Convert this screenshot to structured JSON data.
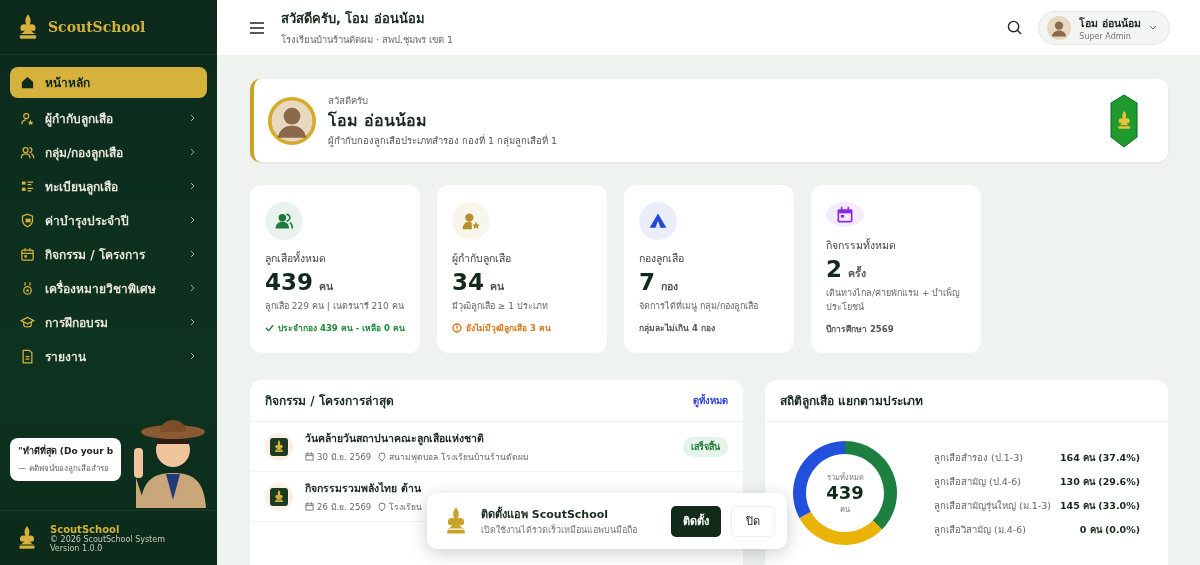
{
  "sidebar": {
    "brand": "ScoutSchool",
    "items": [
      {
        "label": "หน้าหลัก",
        "selected": true,
        "expandable": false
      },
      {
        "label": "ผู้กำกับลูกเสือ",
        "selected": false,
        "expandable": true
      },
      {
        "label": "กลุ่ม/กองลูกเสือ",
        "selected": false,
        "expandable": true
      },
      {
        "label": "ทะเบียนลูกเสือ",
        "selected": false,
        "expandable": true
      },
      {
        "label": "ค่าบำรุงประจำปี",
        "selected": false,
        "expandable": true
      },
      {
        "label": "กิจกรรม / โครงการ",
        "selected": false,
        "expandable": true
      },
      {
        "label": "เครื่องหมายวิชาพิเศษ",
        "selected": false,
        "expandable": true
      },
      {
        "label": "การฝึกอบรม",
        "selected": false,
        "expandable": true
      },
      {
        "label": "รายงาน",
        "selected": false,
        "expandable": true
      }
    ],
    "quote": {
      "text": "\"ทำดีที่สุด (Do your b",
      "source": "— คติพจน์ของลูกเสือสำรอ"
    },
    "footer": {
      "name": "ScoutSchool",
      "copyright": "© 2026 ScoutSchool System",
      "version": "Version 1.0.0"
    }
  },
  "topbar": {
    "greeting": "สวัสดีครับ, โอม อ่อนน้อม",
    "school": "โรงเรียนบ้านร้านตัดผม · สพป.ชุมพร เขต 1",
    "user": {
      "name": "โอม อ่อนน้อม",
      "role": "Super Admin"
    }
  },
  "welcome": {
    "hello": "สวัสดีครับ",
    "name": "โอม อ่อนน้อม",
    "position": "ผู้กำกับกองลูกเสือประเภทสำรอง กองที่ 1 กลุ่มลูกเสือที่ 1"
  },
  "stats": [
    {
      "color": "#1e7a3c",
      "label": "ลูกเสือทั้งหมด",
      "value": "439",
      "unit": "คน",
      "detail": "ลูกเสือ 229 คน | เนตรนารี 210 คน",
      "note": "ประจำกอง 439 คน - เหลือ 0 คน",
      "kind": "ok"
    },
    {
      "color": "#b8912a",
      "label": "ผู้กำกับลูกเสือ",
      "value": "34",
      "unit": "คน",
      "detail": "มีวุฒิลูกเสือ ≥ 1 ประเภท",
      "note": "ยังไม่มีวุฒิลูกเสือ 3 คน",
      "kind": "warning"
    },
    {
      "color": "#2348d8",
      "label": "กองลูกเสือ",
      "value": "7",
      "unit": "กอง",
      "detail": "จัดการได้ที่เมนู กลุ่ม/กองลูกเสือ",
      "note": "กลุ่มละไม่เกิน 4 กอง",
      "kind": "plain"
    },
    {
      "color": "#8a2be2",
      "label": "กิจกรรมทั้งหมด",
      "value": "2",
      "unit": "ครั้ง",
      "detail": "เดินทางไกล/ค่ายพักแรม + บำเพ็ญประโยชน์",
      "note": "ปีการศึกษา 2569",
      "kind": "plain"
    }
  ],
  "activities": {
    "title": "กิจกรรม / โครงการล่าสุด",
    "link": "ดูทั้งหมด",
    "items": [
      {
        "title": "วันคล้ายวันสถาปนาคณะลูกเสือแห่งชาติ",
        "date": "30 มิ.ย. 2569",
        "place": "สนามฟุตบอล โรงเรียนบ้านร้านตัดผม",
        "status": "เสร็จสิ้น"
      },
      {
        "title": "กิจกรรมรวมพลังไทย ต้าน",
        "date": "26 มิ.ย. 2569",
        "place": "โรงเรียน"
      }
    ]
  },
  "scout_stats": {
    "title": "สถิติลูกเสือ แยกตามประเภท",
    "center_label": "รวมทั้งหมด",
    "total": "439",
    "unit": "คน",
    "legend_values": [
      "164 คน (37.4%)",
      "130 คน (29.6%)",
      "145 คน (33.0%)",
      "0 คน (0.0%)"
    ],
    "chart_data": {
      "type": "donut",
      "categories": [
        "ลูกเสือสำรอง (ป.1-3)",
        "ลูกเสือสามัญ (ป.4-6)",
        "ลูกเสือสามัญรุ่นใหญ่ (ม.1-3)",
        "ลูกเสือวิสามัญ (ม.4-6)"
      ],
      "values": [
        37.4,
        29.6,
        33.0,
        0.0
      ],
      "colors": [
        "#1e8040",
        "#eab308",
        "#2150dc",
        "#8a2be2"
      ]
    }
  },
  "install": {
    "title": "ติดตั้งแอพ ScoutSchool",
    "subtitle": "เปิดใช้งานได้รวดเร็วเหมือนแอพบนมือถือ",
    "install": "ติดตั้ง",
    "close": "ปิด"
  }
}
